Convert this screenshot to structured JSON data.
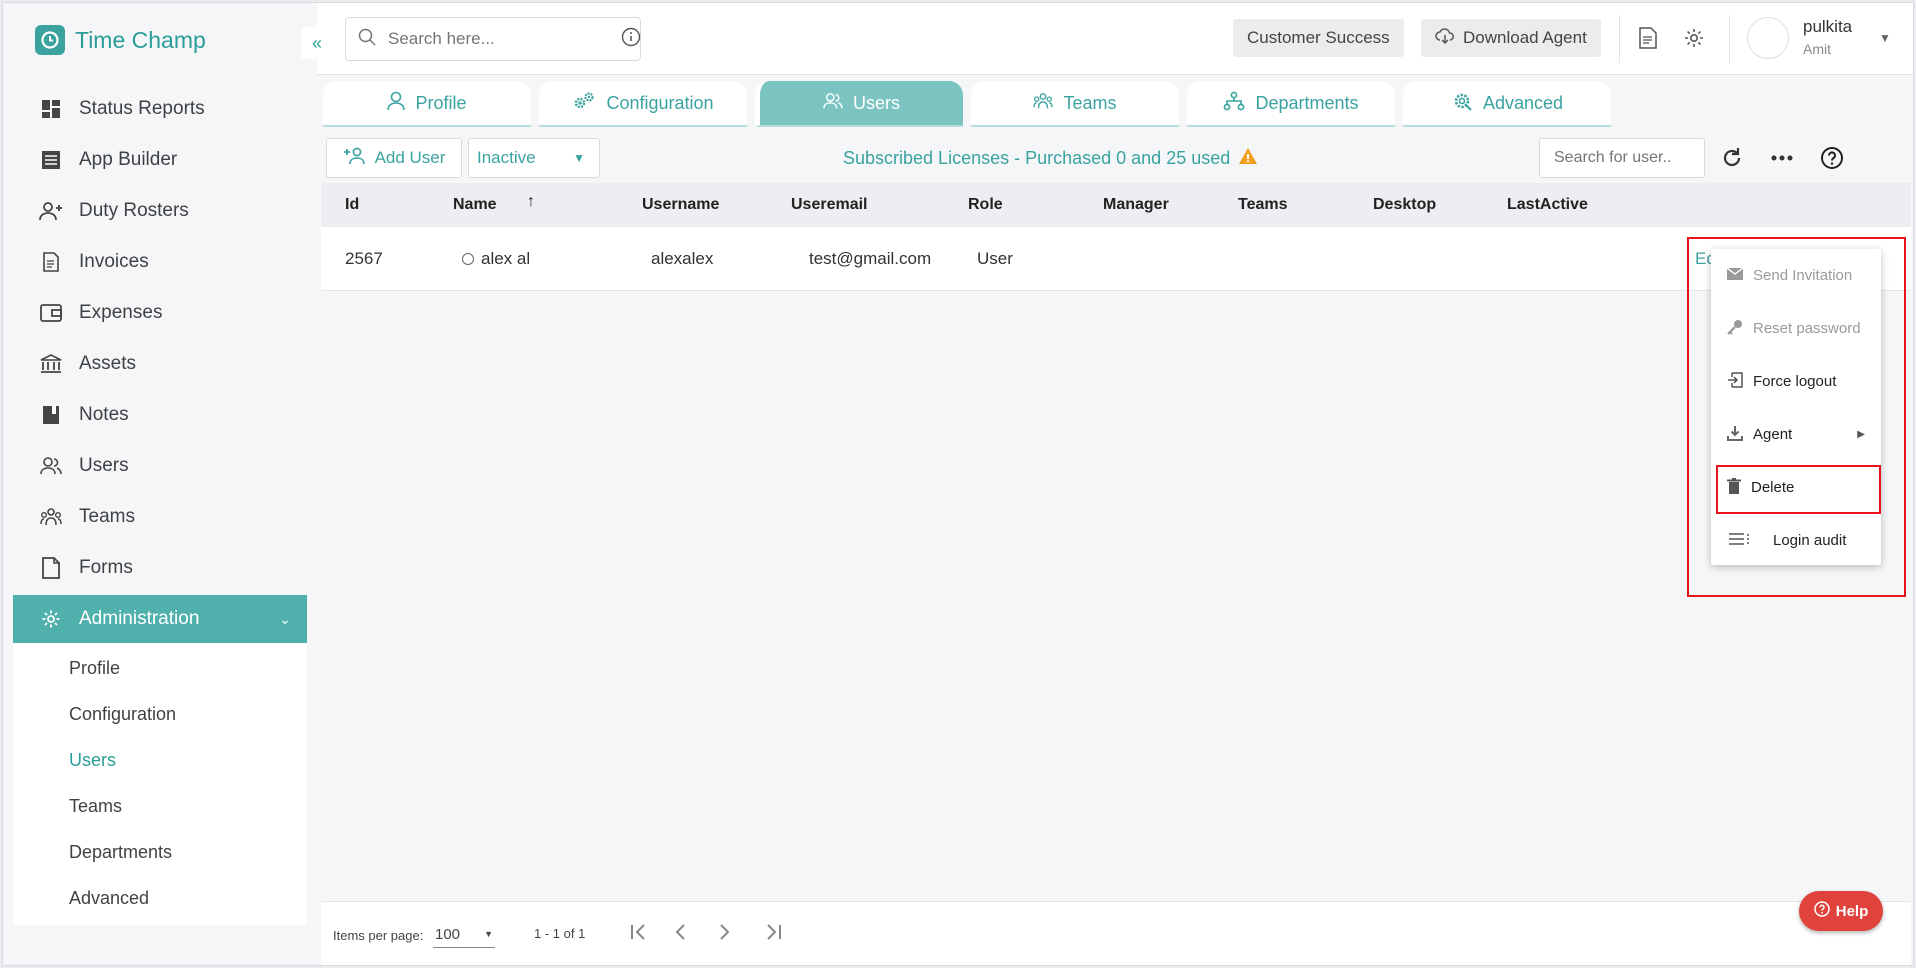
{
  "brand": {
    "name": "Time Champ"
  },
  "header": {
    "search_placeholder": "Search here...",
    "customer_success": "Customer Success",
    "download_agent": "Download Agent",
    "user_name": "pulkita",
    "user_sub": "Amit"
  },
  "sidebar": {
    "items": [
      {
        "label": "Status Reports"
      },
      {
        "label": "App Builder"
      },
      {
        "label": "Duty Rosters"
      },
      {
        "label": "Invoices"
      },
      {
        "label": "Expenses"
      },
      {
        "label": "Assets"
      },
      {
        "label": "Notes"
      },
      {
        "label": "Users"
      },
      {
        "label": "Teams"
      },
      {
        "label": "Forms"
      },
      {
        "label": "Administration"
      }
    ],
    "sub_items": [
      {
        "label": "Profile"
      },
      {
        "label": "Configuration"
      },
      {
        "label": "Users"
      },
      {
        "label": "Teams"
      },
      {
        "label": "Departments"
      },
      {
        "label": "Advanced"
      }
    ]
  },
  "tabs": [
    {
      "label": "Profile"
    },
    {
      "label": "Configuration"
    },
    {
      "label": "Users"
    },
    {
      "label": "Teams"
    },
    {
      "label": "Departments"
    },
    {
      "label": "Advanced"
    }
  ],
  "toolbar": {
    "add_user": "Add User",
    "status_value": "Inactive",
    "licenses": "Subscribed Licenses - Purchased 0 and 25 used",
    "search_placeholder": "Search for user.."
  },
  "table": {
    "columns": [
      "Id",
      "Name",
      "Username",
      "Useremail",
      "Role",
      "Manager",
      "Teams",
      "Desktop",
      "LastActive"
    ],
    "rows": [
      {
        "id": "2567",
        "name": "alex al",
        "username": "alexalex",
        "email": "test@gmail.com",
        "role": "User",
        "edit": "Ed"
      }
    ]
  },
  "menu": {
    "items": [
      {
        "label": "Send Invitation"
      },
      {
        "label": "Reset password"
      },
      {
        "label": "Force logout"
      },
      {
        "label": "Agent"
      },
      {
        "label": "Delete"
      },
      {
        "label": "Login audit"
      }
    ]
  },
  "paginator": {
    "items_per_page_label": "Items per page:",
    "page_size": "100",
    "range": "1 - 1 of 1"
  },
  "help": {
    "label": "Help"
  },
  "colors": {
    "accent": "#3aa3a0",
    "active_nav": "#4fb0ac",
    "active_tab": "#7cc4c1",
    "highlight": "#e8141c",
    "help": "#e0433b"
  }
}
